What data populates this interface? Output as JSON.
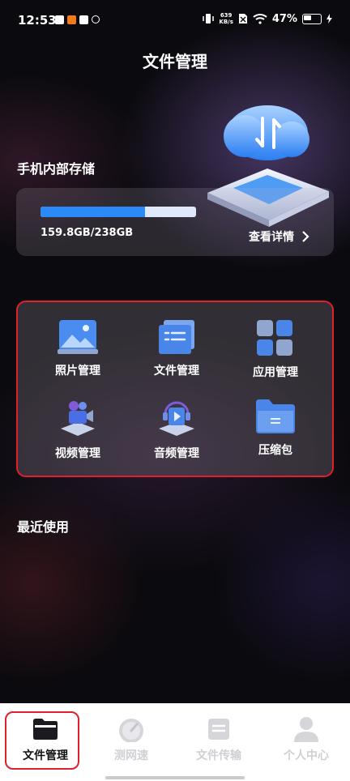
{
  "status_bar": {
    "time": "12:53",
    "net_speed_value": "639",
    "net_speed_unit": "KB/s",
    "battery": "47%"
  },
  "page": {
    "title": "文件管理"
  },
  "storage": {
    "section_label": "手机内部存储",
    "used_text": "159.8GB/238GB",
    "used_fraction": 0.671,
    "detail_label": "查看详情"
  },
  "categories": [
    {
      "label": "照片管理",
      "icon": "photo-icon"
    },
    {
      "label": "文件管理",
      "icon": "document-icon"
    },
    {
      "label": "应用管理",
      "icon": "apps-icon"
    },
    {
      "label": "视频管理",
      "icon": "video-icon"
    },
    {
      "label": "音频管理",
      "icon": "audio-icon"
    },
    {
      "label": "压缩包",
      "icon": "archive-icon"
    }
  ],
  "recent": {
    "section_label": "最近使用"
  },
  "bottom_nav": [
    {
      "label": "文件管理",
      "icon": "folder-icon",
      "active": true
    },
    {
      "label": "测网速",
      "icon": "speedometer-icon",
      "active": false
    },
    {
      "label": "文件传输",
      "icon": "transfer-icon",
      "active": false
    },
    {
      "label": "个人中心",
      "icon": "user-icon",
      "active": false
    }
  ],
  "colors": {
    "accent_blue": "#2b8af7",
    "highlight_red": "#e0202e",
    "background": "#0b0a0e"
  }
}
